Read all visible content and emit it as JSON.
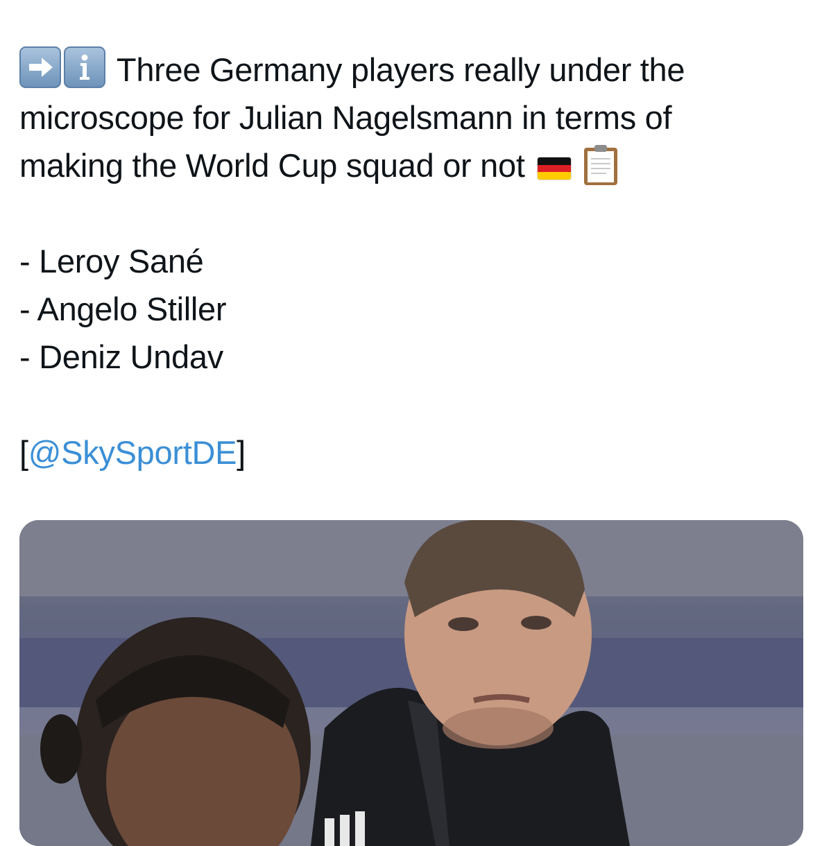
{
  "tweet": {
    "line1": "Three Germany players really under the",
    "line2": "microscope for Julian Nagelsmann in terms of",
    "line3": "making the World Cup squad or not",
    "players": [
      "- Leroy Sané",
      "- Angelo Stiller",
      "- Deniz Undav"
    ],
    "source_open": "[",
    "source_handle": "@SkySportDE",
    "source_close": "]",
    "icons": [
      "right-arrow-emoji-icon",
      "information-emoji-icon",
      "germany-flag-icon",
      "clipboard-icon"
    ]
  },
  "colors": {
    "text": "#0f1419",
    "link": "#3b8fd6",
    "background": "#ffffff"
  }
}
